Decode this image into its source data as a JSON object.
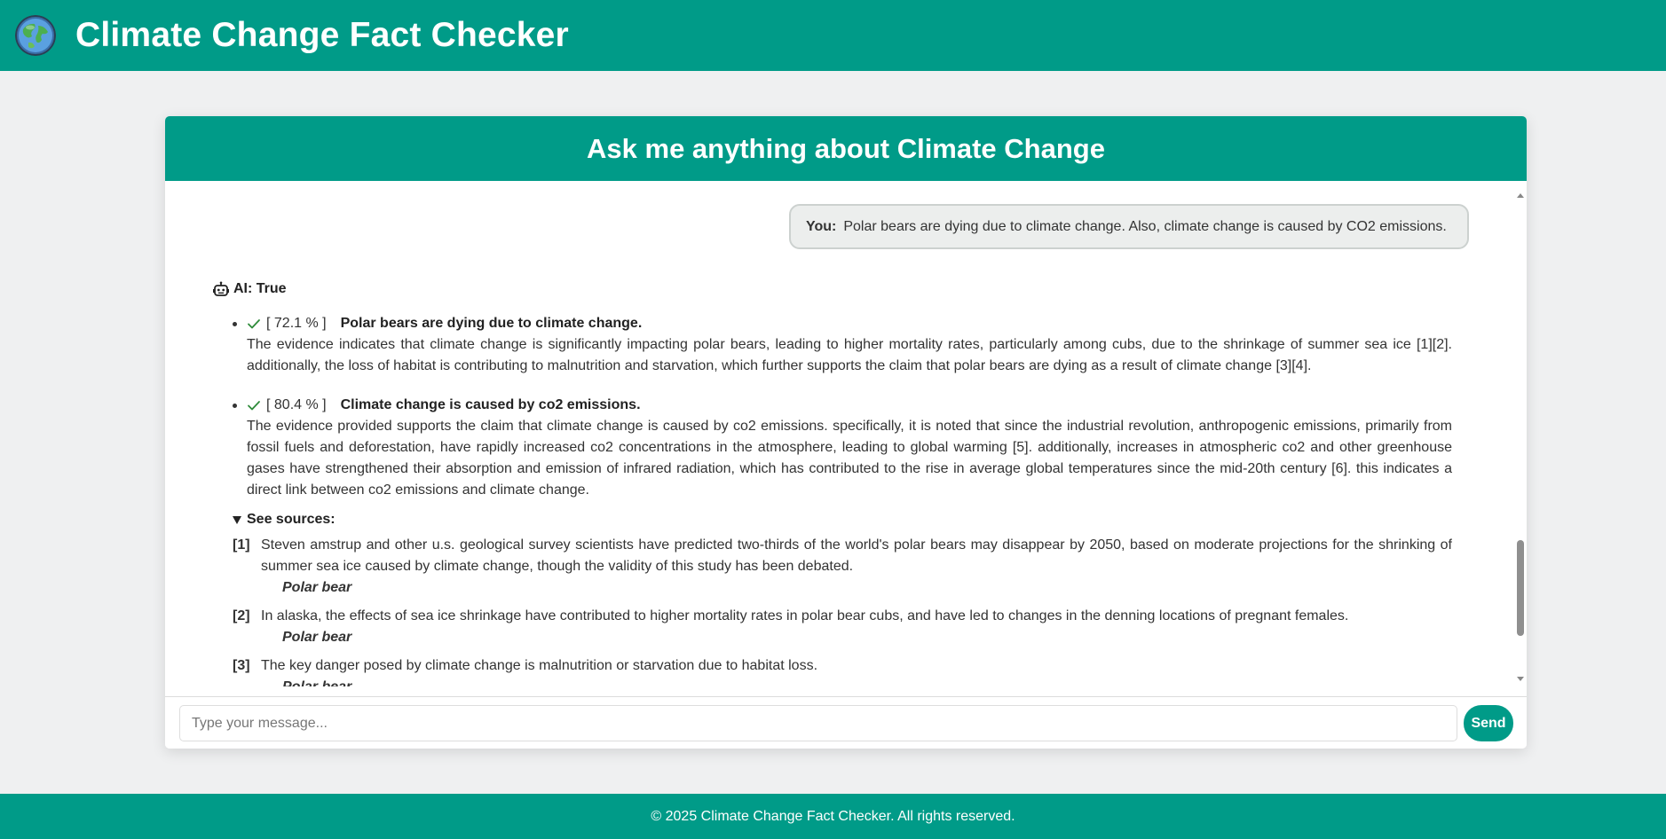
{
  "app": {
    "title": "Climate Change Fact Checker",
    "logo_icon": "globe-icon"
  },
  "chat": {
    "header": "Ask me anything about Climate Change",
    "user_message": {
      "label": "You:",
      "text": "Polar bears are dying due to climate change. Also, climate change is caused by CO2 emissions."
    },
    "ai": {
      "label": "AI: True",
      "icon": "robot-icon",
      "claims": [
        {
          "score": "[ 72.1 % ]",
          "title": "Polar bears are dying due to climate change.",
          "verdict_icon": "check-icon",
          "text": "The evidence indicates that climate change is significantly impacting polar bears, leading to higher mortality rates, particularly among cubs, due to the shrinkage of summer sea ice [1][2]. additionally, the loss of habitat is contributing to malnutrition and starvation, which further supports the claim that polar bears are dying as a result of climate change [3][4]."
        },
        {
          "score": "[ 80.4 % ]",
          "title": "Climate change is caused by co2 emissions.",
          "verdict_icon": "check-icon",
          "text": "The evidence provided supports the claim that climate change is caused by co2 emissions. specifically, it is noted that since the industrial revolution, anthropogenic emissions, primarily from fossil fuels and deforestation, have rapidly increased co2 concentrations in the atmosphere, leading to global warming [5]. additionally, increases in atmospheric co2 and other greenhouse gases have strengthened their absorption and emission of infrared radiation, which has contributed to the rise in average global temperatures since the mid-20th century [6]. this indicates a direct link between co2 emissions and climate change."
        }
      ],
      "sources_label": "See sources:",
      "sources": [
        {
          "num": "[1]",
          "text": "Steven amstrup and other u.s. geological survey scientists have predicted two-thirds of the world's polar bears may disappear by 2050, based on moderate projections for the shrinking of summer sea ice caused by climate change, though the validity of this study has been debated.",
          "title": "Polar bear"
        },
        {
          "num": "[2]",
          "text": "In alaska, the effects of sea ice shrinkage have contributed to higher mortality rates in polar bear cubs, and have led to changes in the denning locations of pregnant females.",
          "title": "Polar bear"
        },
        {
          "num": "[3]",
          "text": "The key danger posed by climate change is malnutrition or starvation due to habitat loss.",
          "title": "Polar bear"
        }
      ]
    },
    "input": {
      "placeholder": "Type your message...",
      "value": ""
    },
    "send_label": "Send"
  },
  "footer": {
    "text": "© 2025 Climate Change Fact Checker. All rights reserved."
  },
  "colors": {
    "primary": "#009b88",
    "background": "#eff0f1",
    "check": "#2e8b3a"
  }
}
